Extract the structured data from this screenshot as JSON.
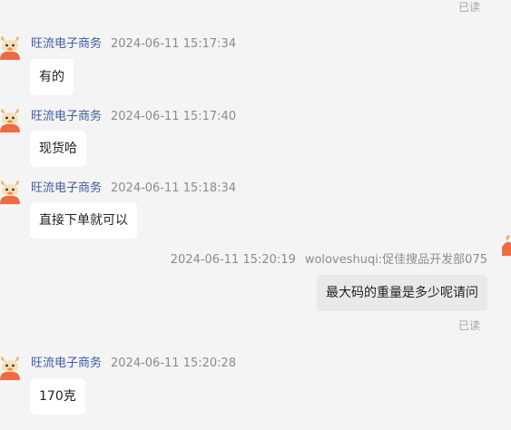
{
  "messages": [
    {
      "sender": "旺流电子商务",
      "time": "2024-06-11 15:17:34",
      "text": "有的"
    },
    {
      "sender": "旺流电子商务",
      "time": "2024-06-11 15:17:40",
      "text": "现货哈"
    },
    {
      "sender": "旺流电子商务",
      "time": "2024-06-11 15:18:34",
      "text": "直接下单就可以"
    },
    {
      "sender": "woloveshuqi:促佳搜品开发部075",
      "time": "2024-06-11 15:20:19",
      "text": "最大码的重量是多少呢请问",
      "status": "已读"
    },
    {
      "sender": "旺流电子商务",
      "time": "2024-06-11 15:20:28",
      "text": "170克"
    }
  ],
  "top_status": "已读",
  "colors": {
    "background": "#f4f4f4",
    "incoming_bubble": "#ffffff",
    "outgoing_bubble": "#e9e9e9",
    "sender_name": "#3b5ba3",
    "timestamp": "#8c8c8c",
    "read_status": "#a5a5a5"
  },
  "icons": {
    "avatar": "orange-ox-mascot-icon"
  }
}
